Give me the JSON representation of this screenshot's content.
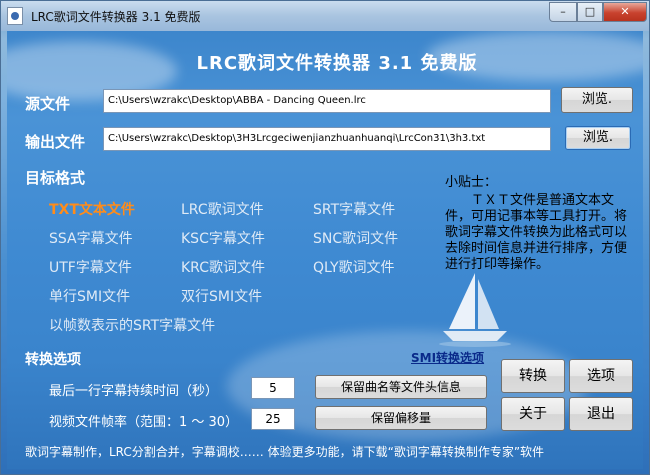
{
  "window": {
    "title": "LRC歌词文件转换器 3.1 免费版"
  },
  "header": {
    "title": "LRC歌词文件转换器  3.1  免费版"
  },
  "source": {
    "label": "源文件",
    "path": "C:\\Users\\wzrakc\\Desktop\\ABBA - Dancing Queen.lrc",
    "browse_label": "浏览."
  },
  "output": {
    "label": "输出文件",
    "path": "C:\\Users\\wzrakc\\Desktop\\3H3Lrcgeciwenjianzhuanhuanqi\\LrcCon31\\3h3.txt",
    "browse_label": "浏览."
  },
  "formats": {
    "label": "目标格式",
    "items": [
      "TXT文本文件",
      "LRC歌词文件",
      "SRT字幕文件",
      "SSA字幕文件",
      "KSC字幕文件",
      "SNC歌词文件",
      "UTF字幕文件",
      "KRC歌词文件",
      "QLY歌词文件",
      "单行SMI文件",
      "双行SMI文件",
      "以帧数表示的SRT字幕文件"
    ],
    "selected": "TXT文本文件"
  },
  "tips": {
    "title": "小贴士：",
    "text": "ＴＸＴ文件是普通文本文件，可用记事本等工具打开。将歌词字幕文件转换为此格式可以去除时间信息并进行排序，方便进行打印等操作。"
  },
  "options": {
    "label": "转换选项",
    "smi_link": "SMI转换选项",
    "last_line_label": "最后一行字幕持续时间（秒）",
    "last_line_value": "5",
    "frame_rate_label": "视频文件帧率（范围：1 ～ 30）",
    "frame_rate_value": "25",
    "keep_header_label": "保留曲名等文件头信息",
    "keep_offset_label": "保留偏移量"
  },
  "actions": {
    "convert": "转换",
    "options": "选项",
    "about": "关于",
    "exit": "退出"
  },
  "status": {
    "text": "歌词字幕制作，LRC分割合并，字幕调校…… 体验更多功能，请下载“歌词字幕转换制作专家”软件"
  },
  "colors": {
    "accent": "#ff8c1a",
    "background": "#3d86cc"
  }
}
